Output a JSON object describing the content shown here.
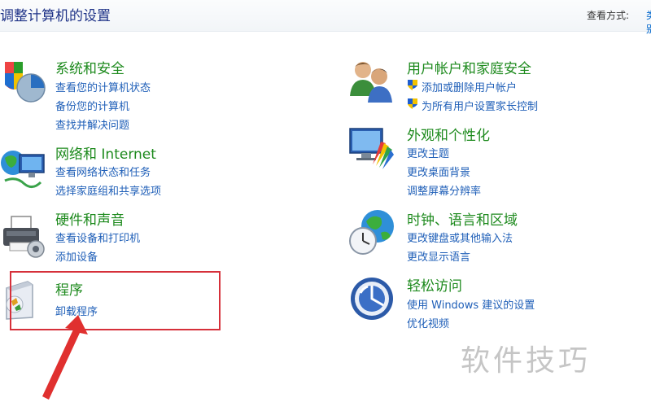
{
  "header": {
    "title": "调整计算机的设置",
    "view_by_label": "查看方式:",
    "view_by_value": "类别"
  },
  "categories": [
    {
      "title": "系统和安全",
      "icon": "system-security-icon",
      "links": [
        "查看您的计算机状态",
        "备份您的计算机",
        "查找并解决问题"
      ]
    },
    {
      "title": "网络和 Internet",
      "icon": "network-icon",
      "links": [
        "查看网络状态和任务",
        "选择家庭组和共享选项"
      ]
    },
    {
      "title": "硬件和声音",
      "icon": "printer-icon",
      "links": [
        "查看设备和打印机",
        "添加设备"
      ]
    },
    {
      "title": "程序",
      "icon": "programs-icon",
      "links": [
        "卸载程序"
      ]
    },
    {
      "title": "用户帐户和家庭安全",
      "icon": "users-icon",
      "links": [
        "添加或删除用户帐户",
        "为所有用户设置家长控制"
      ]
    },
    {
      "title": "外观和个性化",
      "icon": "appearance-icon",
      "links": [
        "更改主题",
        "更改桌面背景",
        "调整屏幕分辨率"
      ]
    },
    {
      "title": "时钟、语言和区域",
      "icon": "clock-globe-icon",
      "links": [
        "更改键盘或其他输入法",
        "更改显示语言"
      ]
    },
    {
      "title": "轻松访问",
      "icon": "ease-of-access-icon",
      "links": [
        "使用 Windows 建议的设置",
        "优化视频"
      ]
    }
  ],
  "annotation": {
    "highlight_color": "#d6303a"
  },
  "watermark": "软件技巧",
  "colors": {
    "title_green": "#1d8a1d",
    "link_blue": "#1f5fb8",
    "header_blue": "#1e3287"
  }
}
